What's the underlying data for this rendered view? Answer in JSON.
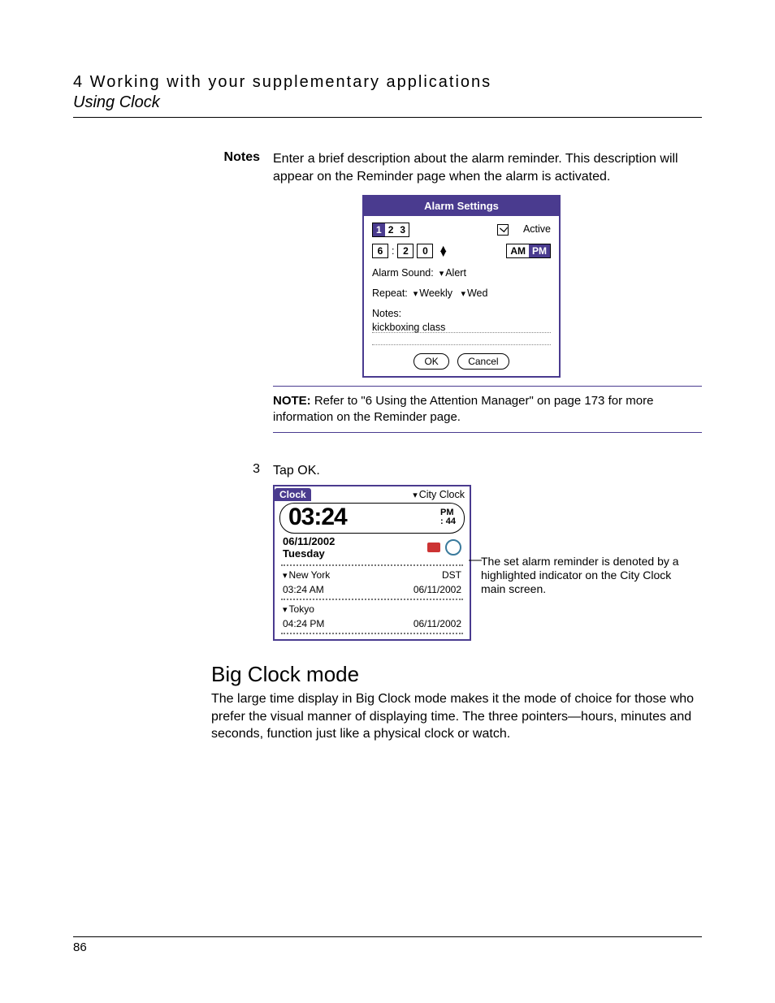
{
  "header": {
    "chapter": "4 Working with your supplementary applications",
    "section": "Using Clock"
  },
  "notes": {
    "label": "Notes",
    "body": "Enter a brief description about the alarm reminder. This description will appear on the Reminder page when the alarm is activated."
  },
  "alarm": {
    "title": "Alarm Settings",
    "tabs": [
      "1",
      "2",
      "3"
    ],
    "tab_sel": 0,
    "active_label": "Active",
    "hour": "6",
    "min_t": "2",
    "min_o": "0",
    "am": "AM",
    "pm": "PM",
    "sound_label": "Alarm Sound:",
    "sound": "Alert",
    "repeat_label": "Repeat:",
    "repeat": "Weekly",
    "day": "Wed",
    "notes_label": "Notes:",
    "note_text": "kickboxing class",
    "ok": "OK",
    "cancel": "Cancel"
  },
  "notebox": {
    "lead": "NOTE:",
    "text": "Refer to \"6 Using the Attention Manager\" on page 173 for more information on the Reminder page."
  },
  "step": {
    "num": "3",
    "text": "Tap OK."
  },
  "clock": {
    "tab": "Clock",
    "menu": "City Clock",
    "time": "03:24",
    "pm": "PM",
    "sec": ": 44",
    "date": "06/11/2002",
    "dow": "Tuesday",
    "cities": [
      {
        "name": "New York",
        "tag": "DST",
        "time": "03:24 AM",
        "date": "06/11/2002"
      },
      {
        "name": "Tokyo",
        "tag": "",
        "time": "04:24 PM",
        "date": "06/11/2002"
      }
    ]
  },
  "callout": "The set alarm reminder is denoted by a highlighted indicator on the City Clock main screen.",
  "big": {
    "title": "Big Clock mode",
    "body": "The large time display in Big Clock mode makes it the mode of choice for those who prefer the visual manner of displaying time. The three pointers—hours, minutes and seconds, function just like a physical clock or watch."
  },
  "page": "86"
}
